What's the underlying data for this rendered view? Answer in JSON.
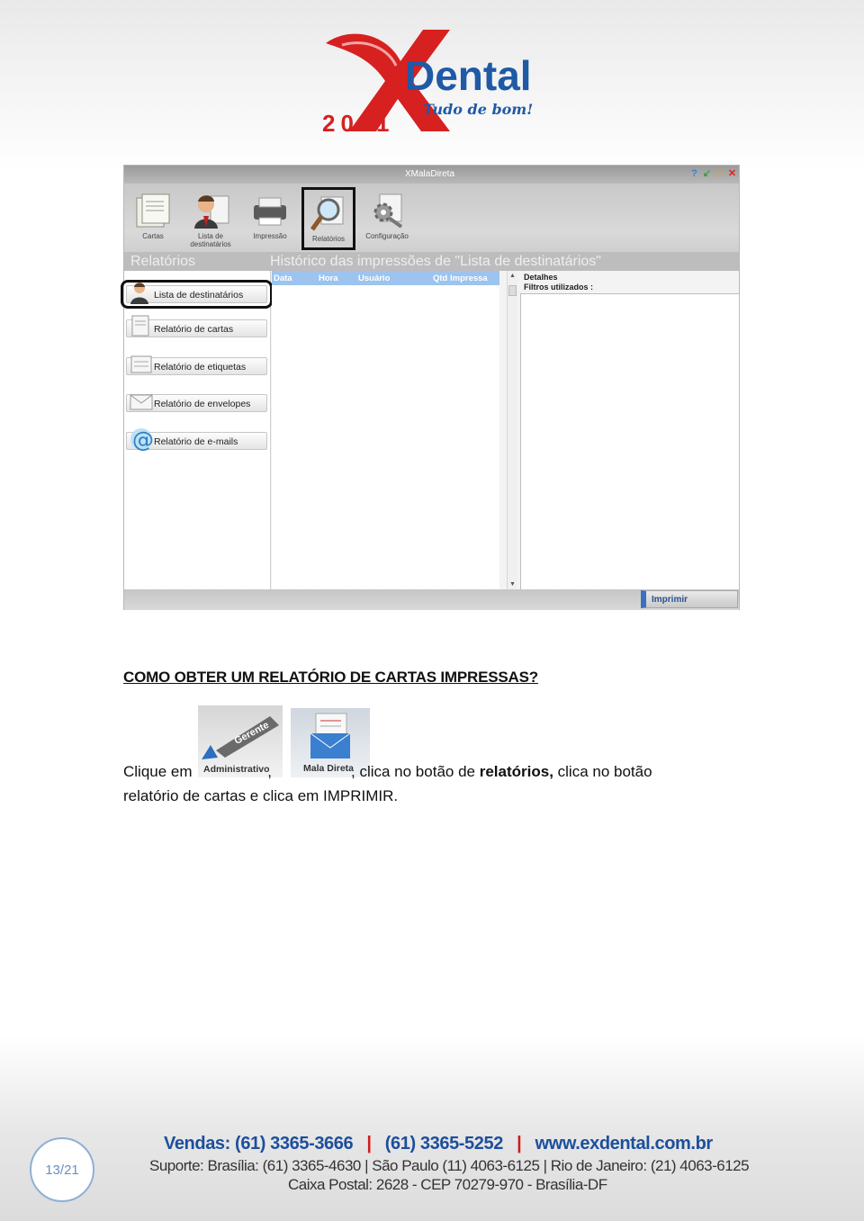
{
  "logo": {
    "year": "2011",
    "brand": "Dental",
    "tagline": "Tudo de bom!"
  },
  "app": {
    "title": "XMalaDireta",
    "toolbar": [
      {
        "label": "Cartas",
        "icon": "letters-icon"
      },
      {
        "label": "Lista de destinatários",
        "icon": "person-icon"
      },
      {
        "label": "Impressão",
        "icon": "printer-icon"
      },
      {
        "label": "Relatórios",
        "icon": "magnifier-icon"
      },
      {
        "label": "Configuração",
        "icon": "gear-icon"
      }
    ],
    "section_left": "Relatórios",
    "section_right": "Histórico das impressões de \"Lista de destinatários\"",
    "reports": [
      {
        "label": "Lista de destinatários",
        "icon": "person-icon"
      },
      {
        "label": "Relatório de cartas",
        "icon": "letter-icon"
      },
      {
        "label": "Relatório de etiquetas",
        "icon": "label-icon"
      },
      {
        "label": "Relatório de envelopes",
        "icon": "envelope-icon"
      },
      {
        "label": "Relatório de e-mails",
        "icon": "at-icon"
      }
    ],
    "grid_headers": [
      "Data",
      "Hora",
      "Usuário",
      "Qtd Impressa"
    ],
    "details_title": "Detalhes",
    "details_filters": "Filtros utilizados :",
    "print_label": "Imprimir"
  },
  "heading": "COMO OBTER UM RELATÓRIO DE CARTAS IMPRESSAS?",
  "para": {
    "p1": "Clique em ",
    "p2": ",",
    "p3": ", clica no botão de ",
    "p4": "relatórios,",
    "p5": " clica no botão",
    "line2": "relatório de cartas e clica em IMPRIMIR."
  },
  "inline_images": {
    "admin_caption": "Administrativo",
    "admin_tag": "Gerente",
    "mala_caption": "Mala Direta"
  },
  "footer": {
    "page": "13/21",
    "sales_label": "Vendas: (61) 3365-3666",
    "sep1": "|",
    "sales_phone2": "(61) 3365-5252",
    "sep2": "|",
    "website": "www.exdental.com.br",
    "support": "Suporte: Brasília: (61) 3365-4630 | São Paulo (11) 4063-6125 | Rio de Janeiro: (21) 4063-6125",
    "address": "Caixa Postal: 2628 - CEP 70279-970 - Brasília-DF"
  }
}
